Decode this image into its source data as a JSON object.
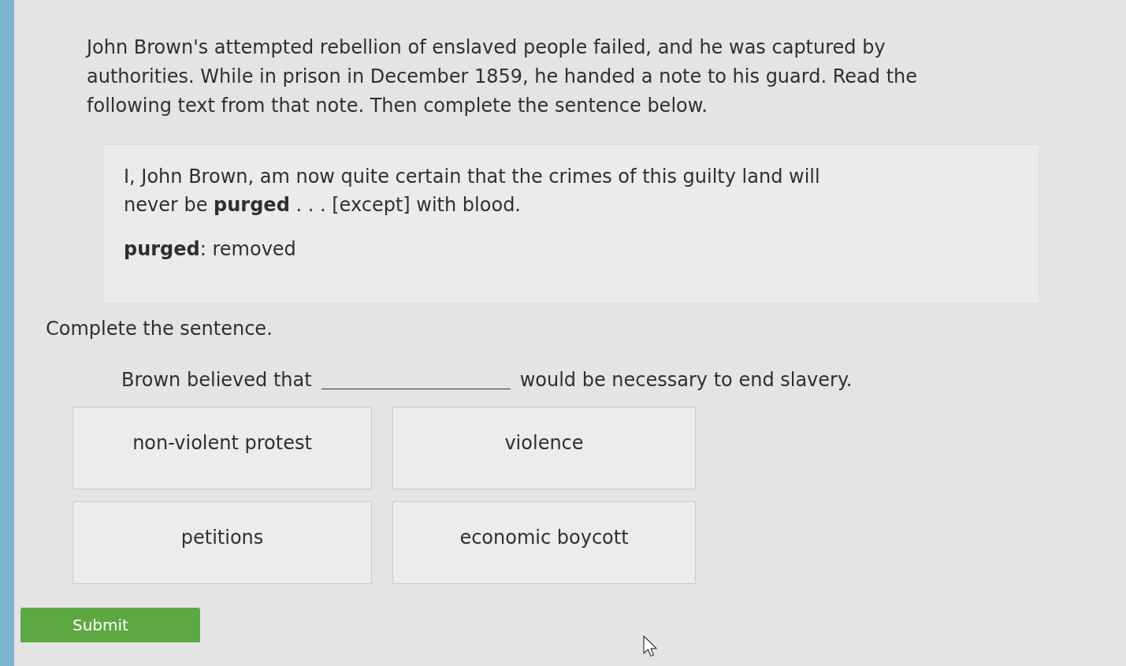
{
  "intro": "John Brown's attempted rebellion of enslaved people failed, and he was captured by authorities. While in prison in December 1859, he handed a note to his guard. Read the following text from that note. Then complete the sentence below.",
  "excerpt": {
    "quote": "I, John Brown, am now quite certain that the crimes of this guilty land will never be **purged** . . . [except] with blood.",
    "glossary": "**purged**: removed"
  },
  "prompt": "Complete the sentence.",
  "sentence": {
    "before": "Brown believed that",
    "after": "would be necessary to end slavery."
  },
  "choices": [
    {
      "label": "non-violent protest",
      "selected": false
    },
    {
      "label": "violence",
      "selected": false
    },
    {
      "label": "petitions",
      "selected": false
    },
    {
      "label": "economic boycott",
      "selected": false
    }
  ],
  "submit": "Submit"
}
